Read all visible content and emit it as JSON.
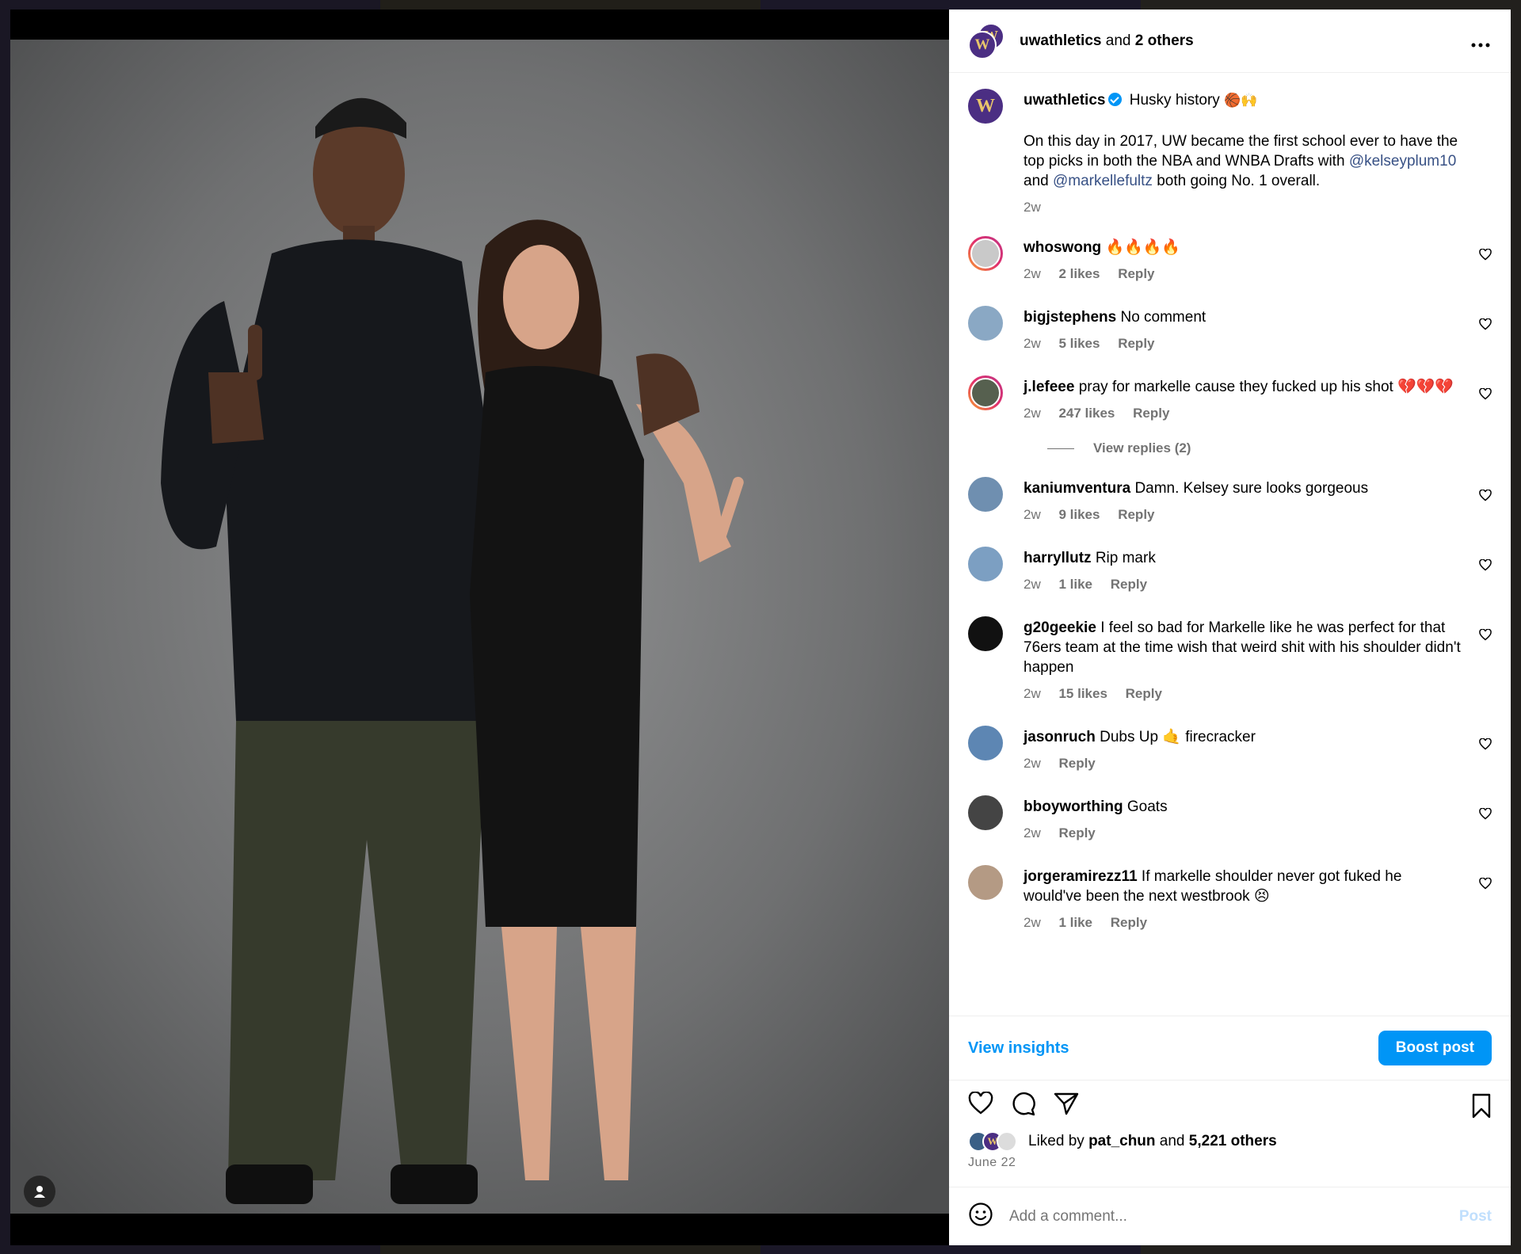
{
  "post": {
    "author": "uwathletics",
    "header_and": "and",
    "header_others": "2 others",
    "caption_head": "Husky history",
    "caption_emoji": "🏀🙌",
    "caption_part1": "On this day in 2017, UW became the first school ever to have the top picks in both the NBA and WNBA Drafts with",
    "mention1": "@kelseyplum10",
    "caption_and": "and",
    "mention2": "@markellefultz",
    "caption_part2": "both going No. 1 overall.",
    "caption_time": "2w",
    "logo_letter": "W"
  },
  "comments": [
    {
      "user": "whoswong",
      "text": "🔥🔥🔥🔥",
      "time": "2w",
      "likes": "2 likes",
      "reply": "Reply"
    },
    {
      "user": "bigjstephens",
      "text": "No comment",
      "time": "2w",
      "likes": "5 likes",
      "reply": "Reply"
    },
    {
      "user": "j.lefeee",
      "text": "pray for markelle cause they fucked up his shot 💔💔💔",
      "time": "2w",
      "likes": "247 likes",
      "reply": "Reply",
      "view_replies": "View replies (2)"
    },
    {
      "user": "kaniumventura",
      "text": "Damn. Kelsey sure looks gorgeous",
      "time": "2w",
      "likes": "9 likes",
      "reply": "Reply"
    },
    {
      "user": "harryllutz",
      "text": "Rip mark",
      "time": "2w",
      "likes": "1 like",
      "reply": "Reply"
    },
    {
      "user": "g20geekie",
      "text": "I feel so bad for Markelle like he was perfect for that 76ers team at the time wish that weird shit with his shoulder didn't happen",
      "time": "2w",
      "likes": "15 likes",
      "reply": "Reply"
    },
    {
      "user": "jasonruch",
      "text": "Dubs Up 🤙 firecracker",
      "time": "2w",
      "likes": "",
      "reply": "Reply"
    },
    {
      "user": "bboyworthing",
      "text": "Goats",
      "time": "2w",
      "likes": "",
      "reply": "Reply"
    },
    {
      "user": "jorgeramirezz11",
      "text": "If markelle shoulder never got fuked he would've been the next westbrook 😣",
      "time": "2w",
      "likes": "1 like",
      "reply": "Reply"
    }
  ],
  "footer": {
    "view_insights": "View insights",
    "boost_post": "Boost post",
    "liked_prefix": "Liked by",
    "liked_user": "pat_chun",
    "liked_and": "and",
    "liked_others": "5,221 others",
    "date": "June 22",
    "add_comment_placeholder": "Add a comment...",
    "post_button": "Post"
  },
  "icons": {
    "more": "more-options-icon",
    "like": "heart-icon",
    "comment": "comment-icon",
    "share": "share-icon",
    "save": "bookmark-icon",
    "emoji": "emoji-icon",
    "tag": "user-tag-icon"
  },
  "colors": {
    "accent": "#0095f6",
    "brand_purple": "#4b2e83",
    "brand_gold": "#e8c56b",
    "muted": "#737373"
  }
}
